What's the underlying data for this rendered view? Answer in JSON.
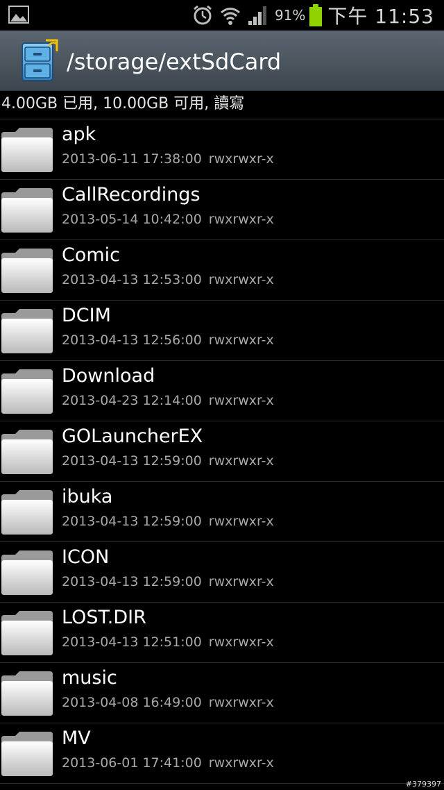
{
  "status_bar": {
    "battery_percent": "91%",
    "clock": "下午 11:53",
    "icons": [
      "image-icon",
      "alarm-icon",
      "wifi-icon",
      "signal-icon",
      "battery-icon"
    ]
  },
  "title_bar": {
    "app_icon": "file-cabinet-icon",
    "path": "/storage/extSdCard"
  },
  "storage_info": "4.00GB 已用, 10.00GB 可用, 讀寫",
  "files": [
    {
      "name": "apk",
      "date": "2013-06-11 17:38:00",
      "perm": "rwxrwxr-x"
    },
    {
      "name": "CallRecordings",
      "date": "2013-05-14 10:42:00",
      "perm": "rwxrwxr-x"
    },
    {
      "name": "Comic",
      "date": "2013-04-13 12:53:00",
      "perm": "rwxrwxr-x"
    },
    {
      "name": "DCIM",
      "date": "2013-04-13 12:56:00",
      "perm": "rwxrwxr-x"
    },
    {
      "name": "Download",
      "date": "2013-04-23 12:14:00",
      "perm": "rwxrwxr-x"
    },
    {
      "name": "GOLauncherEX",
      "date": "2013-04-13 12:59:00",
      "perm": "rwxrwxr-x"
    },
    {
      "name": "ibuka",
      "date": "2013-04-13 12:59:00",
      "perm": "rwxrwxr-x"
    },
    {
      "name": "ICON",
      "date": "2013-04-13 12:59:00",
      "perm": "rwxrwxr-x"
    },
    {
      "name": "LOST.DIR",
      "date": "2013-04-13 12:51:00",
      "perm": "rwxrwxr-x"
    },
    {
      "name": "music",
      "date": "2013-04-08 16:49:00",
      "perm": "rwxrwxr-x"
    },
    {
      "name": "MV",
      "date": "2013-06-01 17:41:00",
      "perm": "rwxrwxr-x"
    }
  ],
  "watermark": "#379397",
  "colors": {
    "background": "#000000",
    "title_bar": "#4d575f",
    "battery": "#8fd400",
    "meta_text": "#a8a8a8"
  }
}
